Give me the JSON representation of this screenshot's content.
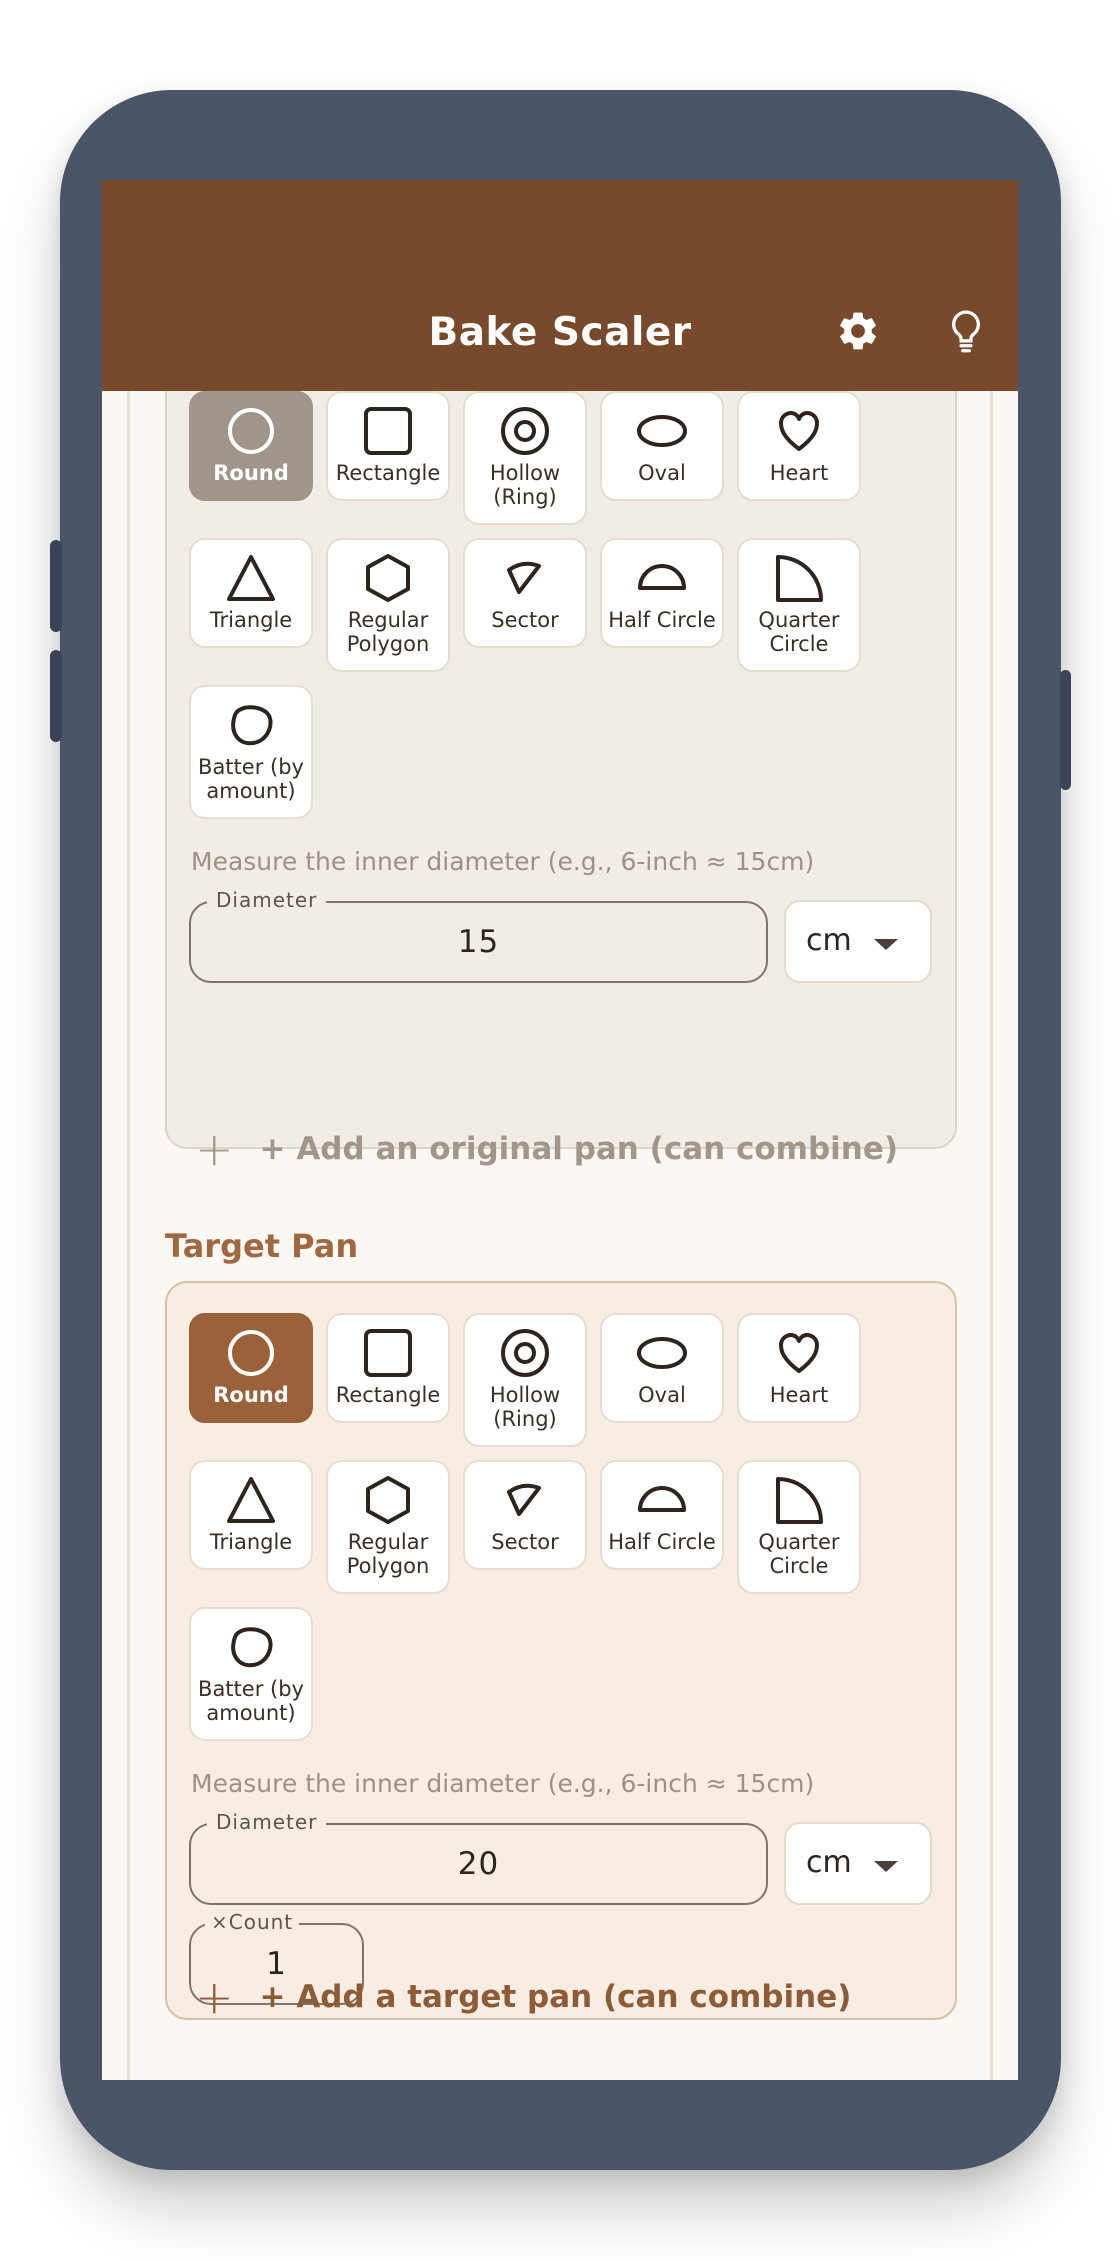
{
  "app": {
    "title": "Bake Scaler",
    "settings_icon": "gear-icon",
    "tips_icon": "lightbulb-icon"
  },
  "colors": {
    "app_bar": "#774a2c",
    "accent": "#9a613a",
    "selected_original": "#a0958a"
  },
  "shape_options": [
    {
      "label": "Round",
      "icon": "circle-icon"
    },
    {
      "label": "Rectangle",
      "icon": "square-icon"
    },
    {
      "label": "Hollow (Ring)",
      "icon": "ring-icon"
    },
    {
      "label": "Oval",
      "icon": "oval-icon"
    },
    {
      "label": "Heart",
      "icon": "heart-icon"
    },
    {
      "label": "Triangle",
      "icon": "triangle-icon"
    },
    {
      "label": "Regular Polygon",
      "icon": "hexagon-icon"
    },
    {
      "label": "Sector",
      "icon": "sector-icon"
    },
    {
      "label": "Half Circle",
      "icon": "half-circle-icon"
    },
    {
      "label": "Quarter Circle",
      "icon": "quarter-circle-icon"
    },
    {
      "label": "Batter (by amount)",
      "icon": "blob-icon"
    }
  ],
  "original_pan": {
    "selected_shape": "Round",
    "hint": "Measure the inner diameter (e.g., 6-inch ≈ 15cm)",
    "diameter_label": "Diameter",
    "diameter_value": "15",
    "unit": "cm",
    "add_label": "+ Add an original pan (can combine)"
  },
  "target_pan": {
    "section_title": "Target Pan",
    "selected_shape": "Round",
    "hint": "Measure the inner diameter (e.g., 6-inch ≈ 15cm)",
    "diameter_label": "Diameter",
    "diameter_value": "20",
    "unit": "cm",
    "count_label": "×Count",
    "count_value": "1",
    "add_label": "+ Add a target pan (can combine)"
  }
}
